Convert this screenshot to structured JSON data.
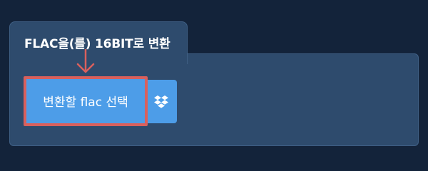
{
  "panel": {
    "title": "FLAC을(를) 16BIT로 변환"
  },
  "actions": {
    "convert_label": "변환할 flac 선택",
    "dropbox_icon": "dropbox-icon"
  },
  "colors": {
    "background": "#13233a",
    "panel": "#2e4b6d",
    "button": "#4d9de8",
    "highlight": "#d9605d"
  }
}
